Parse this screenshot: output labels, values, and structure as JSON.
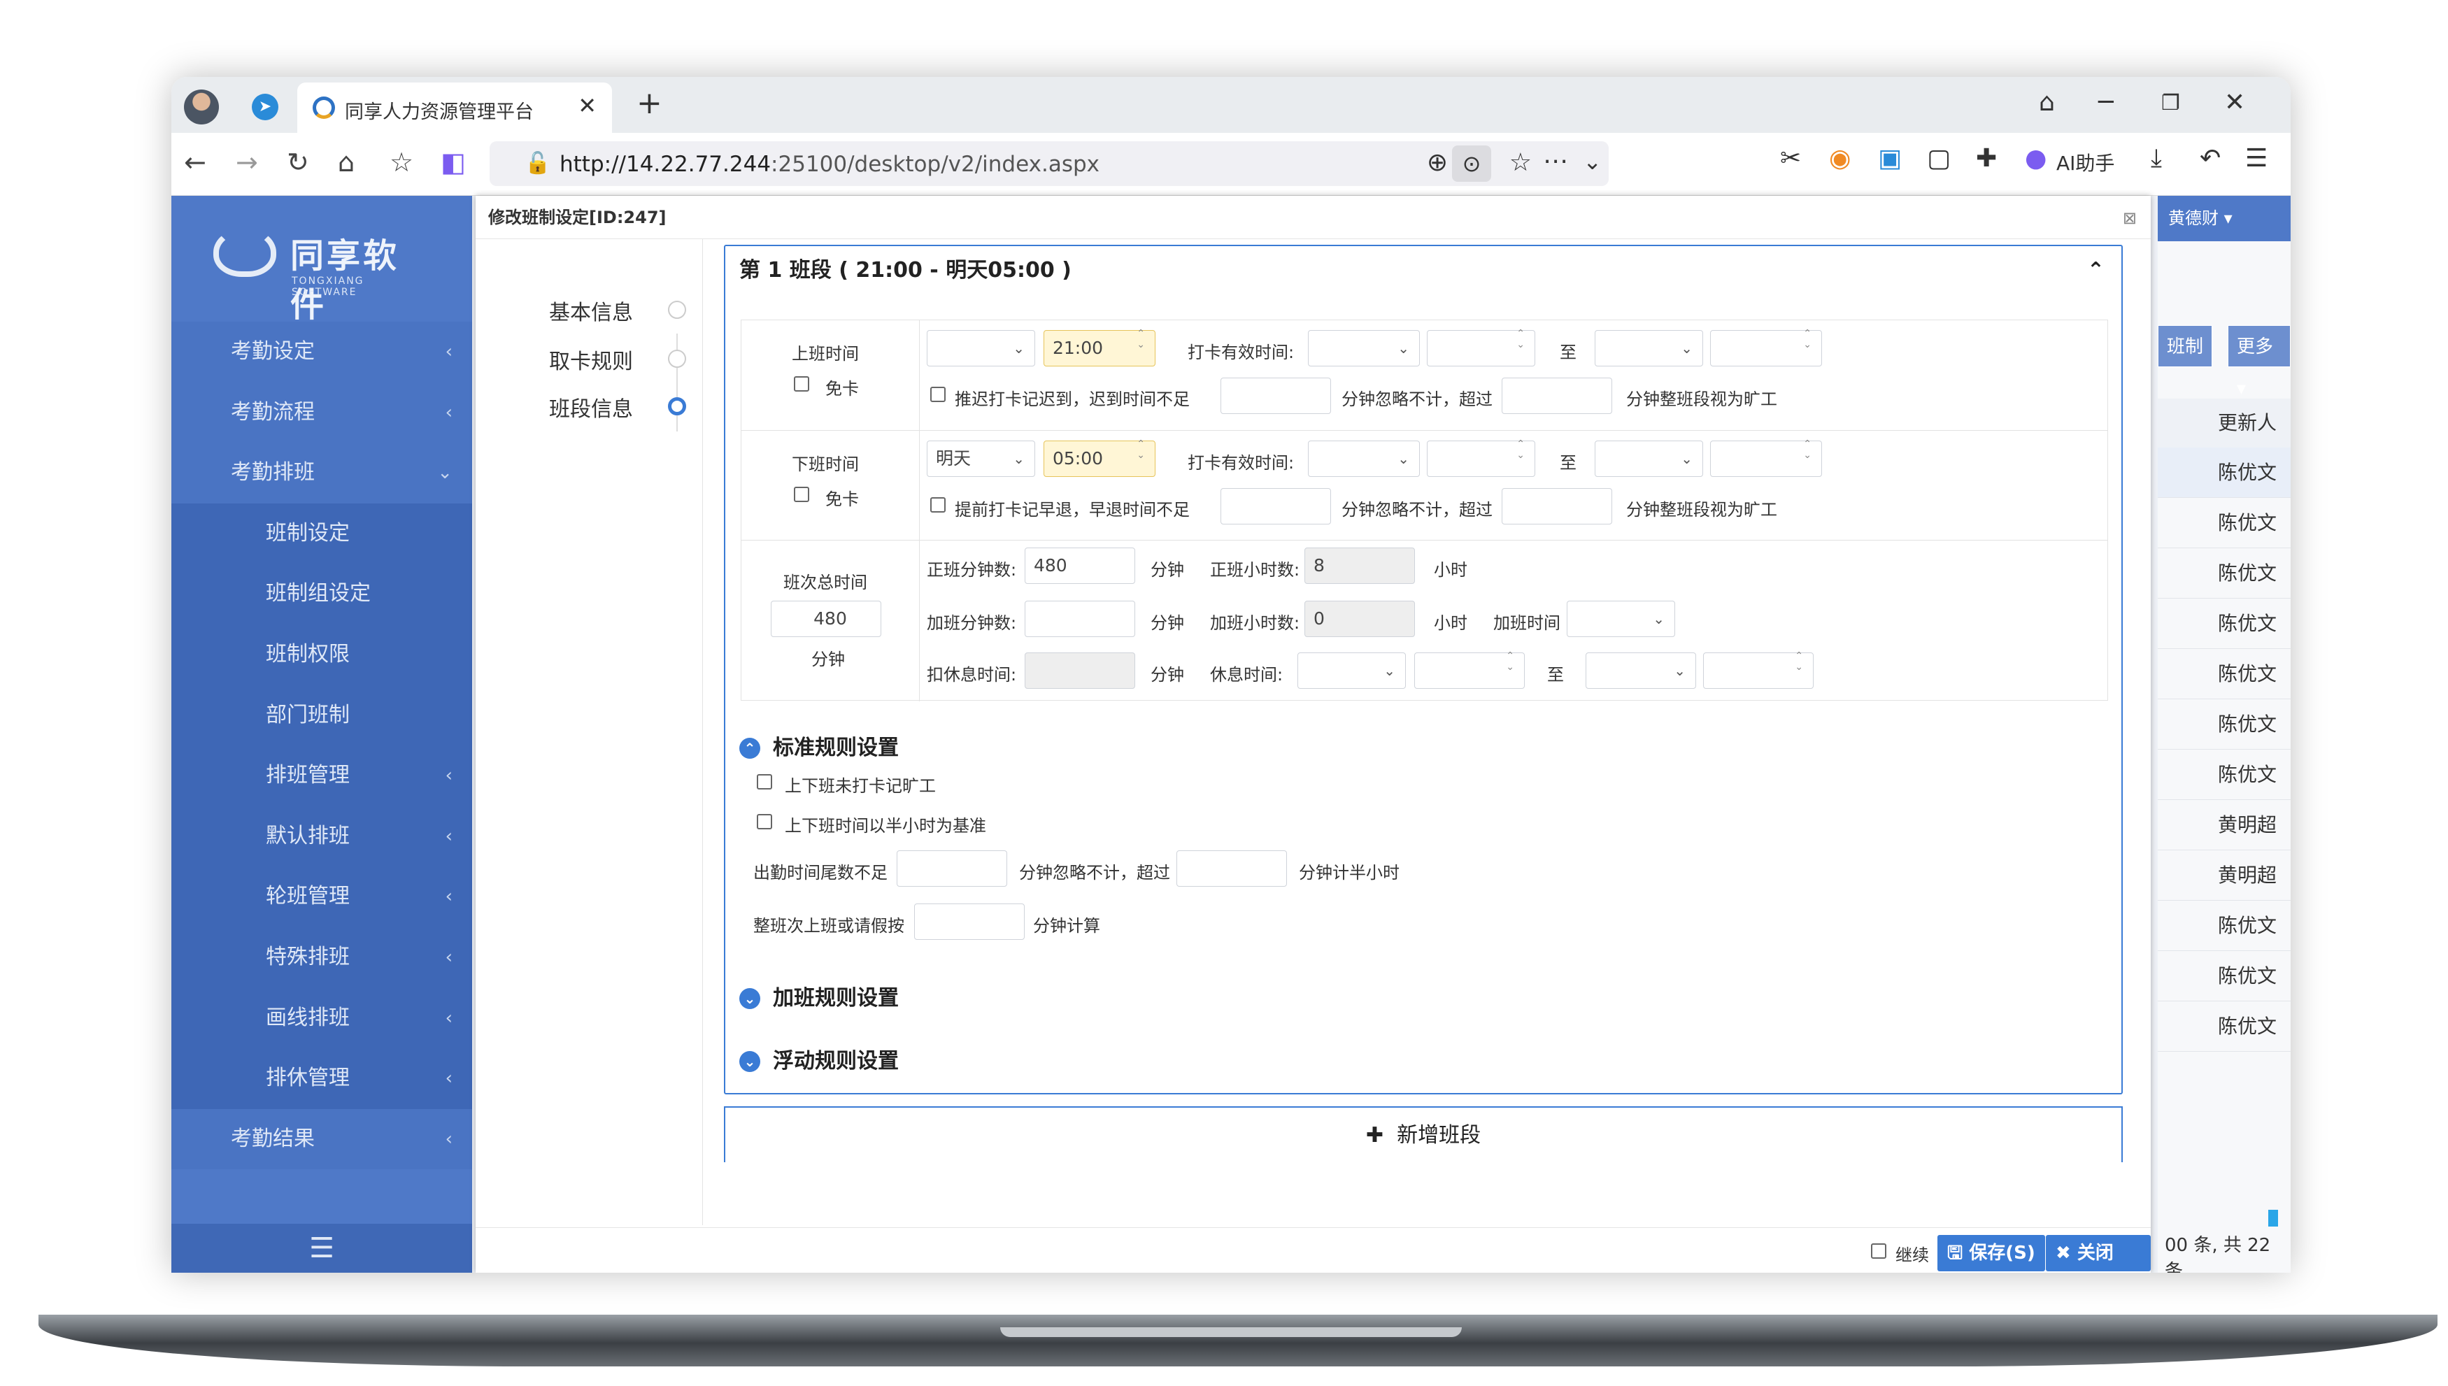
{
  "browser": {
    "tab_title": "同享人力资源管理平台",
    "url_host": "http://14.22.77.244",
    "url_rest": ":25100/desktop/v2/index.aspx",
    "ai_label": "AI助手"
  },
  "app": {
    "logo_cn": "同享软件",
    "logo_en": "TONGXIANG SOFTWARE",
    "menu": [
      {
        "label": "考勤设定",
        "level": 1,
        "chev": "‹"
      },
      {
        "label": "考勤流程",
        "level": 1,
        "chev": "‹"
      },
      {
        "label": "考勤排班",
        "level": 1,
        "chev": "⌄"
      },
      {
        "label": "班制设定",
        "level": 2,
        "chev": ""
      },
      {
        "label": "班制组设定",
        "level": 2,
        "chev": ""
      },
      {
        "label": "班制权限",
        "level": 2,
        "chev": ""
      },
      {
        "label": "部门班制",
        "level": 2,
        "chev": ""
      },
      {
        "label": "排班管理",
        "level": 2,
        "chev": "‹"
      },
      {
        "label": "默认排班",
        "level": 2,
        "chev": "‹"
      },
      {
        "label": "轮班管理",
        "level": 2,
        "chev": "‹"
      },
      {
        "label": "特殊排班",
        "level": 2,
        "chev": "‹"
      },
      {
        "label": "画线排班",
        "level": 2,
        "chev": "‹"
      },
      {
        "label": "排休管理",
        "level": 2,
        "chev": "‹"
      },
      {
        "label": "考勤结果",
        "level": 1,
        "chev": "‹"
      }
    ],
    "bg_user": "黄德财",
    "bg_btn1": "班制",
    "bg_btn2": "更多",
    "bg_col": "更新人",
    "bg_rows": [
      "陈优文",
      "陈优文",
      "陈优文",
      "陈优文",
      "陈优文",
      "陈优文",
      "陈优文",
      "黄明超",
      "黄明超",
      "陈优文",
      "陈优文",
      "陈优文"
    ],
    "bg_footer": "00 条, 共 22 条"
  },
  "modal": {
    "title": "修改班制设定[ID:247]",
    "steps": [
      "基本信息",
      "取卡规则",
      "班段信息"
    ],
    "segment_header": "第 1 班段 ( 21:00 - 明天05:00 )",
    "on_duty": {
      "label": "上班时间",
      "exempt": "免卡",
      "day": "",
      "time": "21:00",
      "valid_label": "打卡有效时间:",
      "to": "至",
      "late_text": "推迟打卡记迟到，迟到时间不足",
      "ignore_text": "分钟忽略不计，超过",
      "absent_text": "分钟整班段视为旷工"
    },
    "off_duty": {
      "label": "下班时间",
      "exempt": "免卡",
      "day": "明天",
      "time": "05:00",
      "valid_label": "打卡有效时间:",
      "to": "至",
      "early_text": "提前打卡记早退，早退时间不足",
      "ignore_text": "分钟忽略不计，超过",
      "absent_text": "分钟整班段视为旷工"
    },
    "total": {
      "label": "班次总时间",
      "value": "480",
      "unit": "分钟",
      "regular_min_label": "正班分钟数:",
      "regular_min": "480",
      "min_unit": "分钟",
      "regular_hr_label": "正班小时数:",
      "regular_hr": "8",
      "hr_unit": "小时",
      "ot_min_label": "加班分钟数:",
      "ot_min": "",
      "ot_hr_label": "加班小时数:",
      "ot_hr": "0",
      "ot_time_label": "加班时间",
      "deduct_label": "扣休息时间:",
      "rest_label": "休息时间:",
      "to": "至"
    },
    "standard_rules": {
      "title": "标准规则设置",
      "cb1": "上下班未打卡记旷工",
      "cb2": "上下班时间以半小时为基准",
      "tail_label": "出勤时间尾数不足",
      "tail_ignore": "分钟忽略不计，超过",
      "tail_half": "分钟计半小时",
      "leave_label": "整班次上班或请假按",
      "leave_unit": "分钟计算"
    },
    "overtime_rules": "加班规则设置",
    "float_rules": "浮动规则设置",
    "add_segment": "新增班段",
    "footer": {
      "continue": "继续",
      "save": "保存(S)",
      "close": "关闭(Q)"
    }
  }
}
